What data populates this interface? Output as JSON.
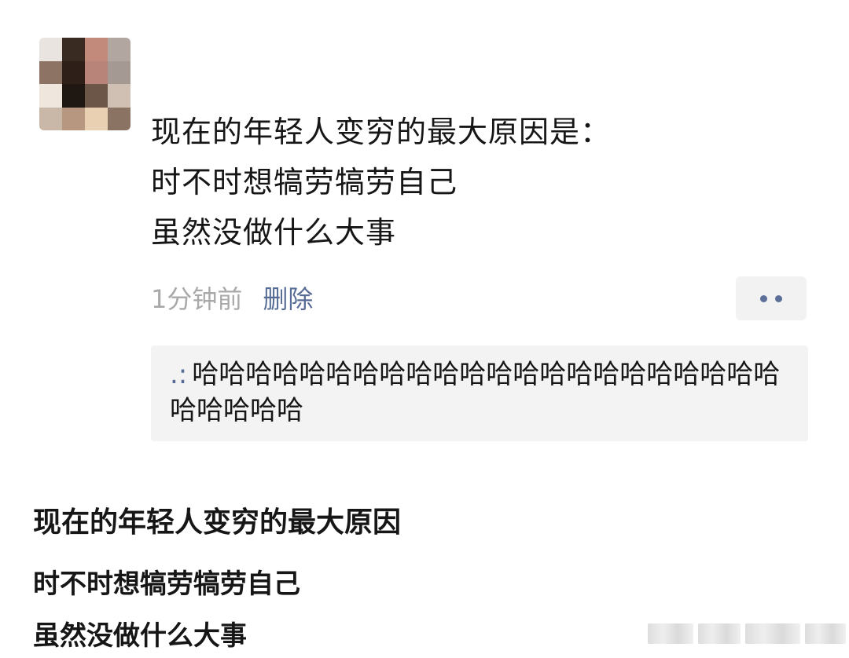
{
  "post": {
    "lines": [
      "现在的年轻人变穷的最大原因是：",
      "时不时想犒劳犒劳自己",
      "虽然没做什么大事"
    ],
    "time": "1分钟前",
    "delete_label": "删除"
  },
  "comment": {
    "author": ".:",
    "text": "哈哈哈哈哈哈哈哈哈哈哈哈哈哈哈哈哈哈哈哈哈哈哈哈哈哈哈"
  },
  "caption": {
    "lines": [
      "现在的年轻人变穷的最大原因",
      "时不时想犒劳犒劳自己",
      "虽然没做什么大事"
    ]
  },
  "colors": {
    "link": "#566b95",
    "muted": "#a9a9a9",
    "text": "#161616",
    "comment_bg": "#f3f3f3"
  },
  "icons": {
    "more": "more-dots-icon",
    "avatar": "pixelated-avatar"
  }
}
